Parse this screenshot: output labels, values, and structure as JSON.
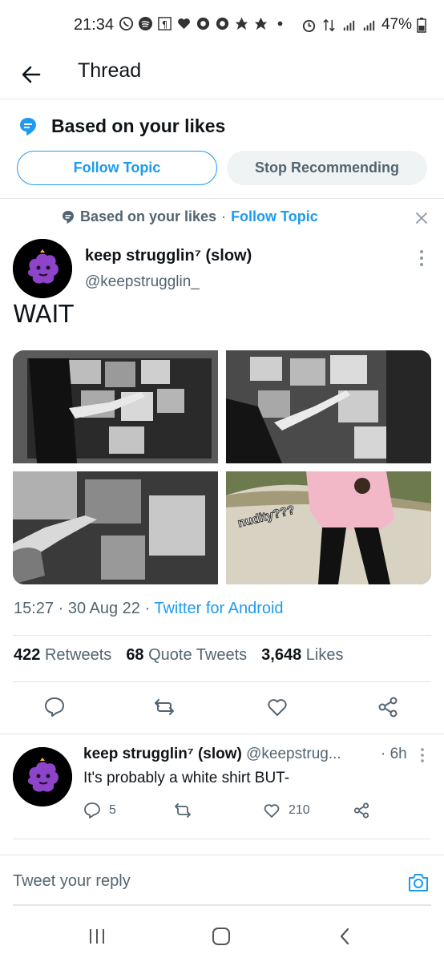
{
  "status_bar": {
    "time": "21:34",
    "battery": "47%"
  },
  "header": {
    "title": "Thread"
  },
  "topic": {
    "title": "Based on your likes",
    "follow_label": "Follow Topic",
    "stop_label": "Stop Recommending"
  },
  "context": {
    "text": "Based on your likes",
    "separator": "·",
    "link": "Follow Topic"
  },
  "tweet": {
    "name": "keep strugglin⁷ (slow)",
    "handle": "@keepstrugglin_",
    "text": "WAIT",
    "media_overlay_text": "nudity???",
    "time": "15:27",
    "date": "30 Aug 22",
    "source": "Twitter for Android",
    "retweets": "422",
    "retweets_label": "Retweets",
    "quotes": "68",
    "quotes_label": "Quote Tweets",
    "likes": "3,648",
    "likes_label": "Likes"
  },
  "reply": {
    "name": "keep strugglin⁷ (slow)",
    "handle": "@keepstrug...",
    "time": "· 6h",
    "text": "It's probably a white shirt BUT-",
    "replies": "5",
    "likes": "210"
  },
  "compose": {
    "placeholder": "Tweet your reply"
  },
  "colors": {
    "accent": "#1d9bf0",
    "text": "#0f1419",
    "secondary": "#536471",
    "avatar_purple": "#8e44c8"
  }
}
